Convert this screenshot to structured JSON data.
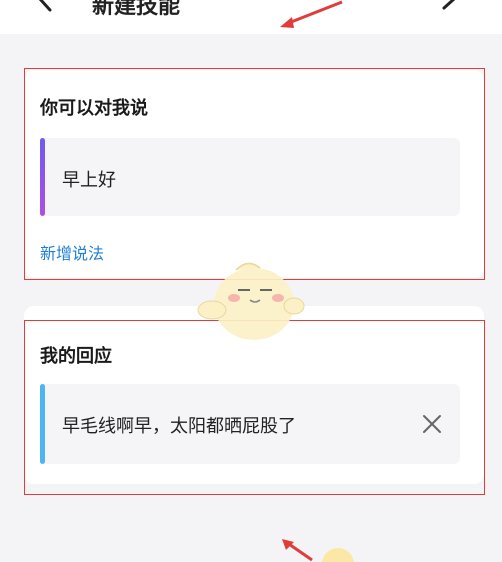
{
  "header": {
    "title": "新建技能"
  },
  "trigger_card": {
    "title": "你可以对我说",
    "phrase": "早上好",
    "add_link": "新增说法",
    "accent_color": "#8b4fe6"
  },
  "response_card": {
    "title": "我的回应",
    "response": "早毛线啊早，太阳都晒屁股了",
    "accent_color": "#4fb4f2"
  },
  "icons": {
    "back": "chevron-left-icon",
    "top_right": "chevron-right-icon",
    "close": "close-icon"
  },
  "colors": {
    "annotation_red": "#e23b3b",
    "link_blue": "#1e7fd8"
  }
}
